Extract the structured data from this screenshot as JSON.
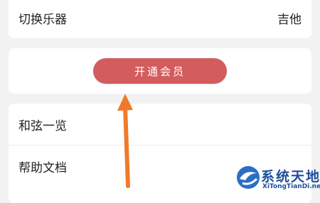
{
  "settings": {
    "switch_instrument": {
      "label": "切换乐器",
      "value": "吉他"
    }
  },
  "member": {
    "button_label": "开通会员"
  },
  "menu": {
    "items": [
      {
        "label": "和弦一览"
      },
      {
        "label": "帮助文档"
      }
    ]
  },
  "watermark": {
    "title": "系统天地",
    "url": "XiTongTianDi.net"
  },
  "colors": {
    "member_button": "#d25c5e",
    "arrow": "#f07a2a",
    "page_background": "#f2f2f2",
    "watermark": "#1e4f9c"
  }
}
